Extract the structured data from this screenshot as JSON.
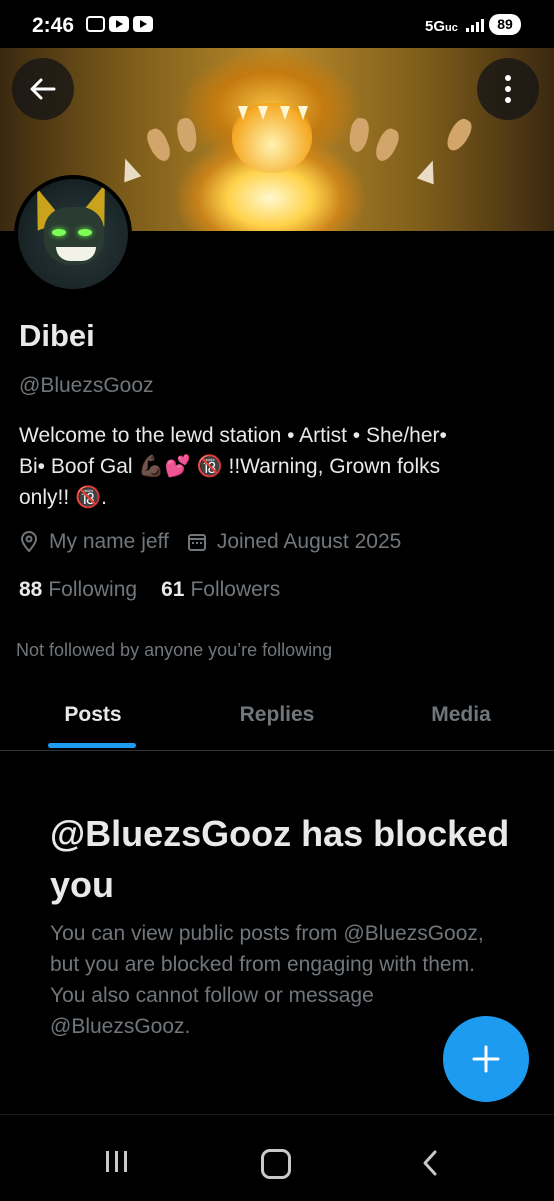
{
  "status_bar": {
    "time": "2:46",
    "network": "5G",
    "battery": "89"
  },
  "profile": {
    "name": "Dibei",
    "handle": "@BluezsGooz",
    "bio": "Welcome to the lewd station • Artist • She/her•\nBi• Boof Gal 💪🏿💕   🔞 !!Warning, Grown folks\nonly!!  🔞.",
    "location": "My name jeff",
    "joined": "Joined August 2025",
    "following_count": "88",
    "following_label": "Following",
    "followers_count": "61",
    "followers_label": "Followers",
    "not_followed_text": "Not followed by anyone you’re following"
  },
  "tabs": [
    {
      "label": "Posts",
      "active": true
    },
    {
      "label": "Replies",
      "active": false
    },
    {
      "label": "Media",
      "active": false
    }
  ],
  "blocked": {
    "title": "@BluezsGooz has blocked you",
    "description": "You can view public posts from @BluezsGooz, but you are blocked from engaging with them. You also cannot follow or message @BluezsGooz."
  },
  "colors": {
    "accent": "#1d9bf0",
    "background": "#000000",
    "text_primary": "#e7e9ea",
    "text_secondary": "#71767b"
  },
  "icons": {
    "back": "arrow-left-icon",
    "more": "more-vertical-icon",
    "location": "location-pin-icon",
    "calendar": "calendar-icon",
    "compose": "plus-icon"
  }
}
